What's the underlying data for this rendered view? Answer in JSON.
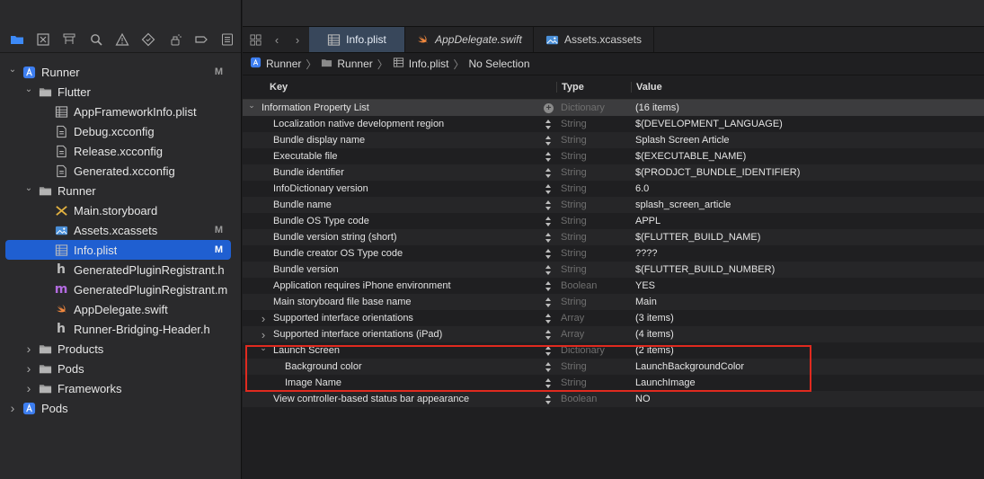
{
  "navigator": {
    "toolbar_icons": [
      "folder-icon",
      "source-control-icon",
      "hierarchy-icon",
      "search-icon",
      "issue-warning-icon",
      "test-diamond-icon",
      "debug-spray-icon",
      "breakpoint-icon",
      "report-list-icon"
    ],
    "tree": [
      {
        "label": "Runner",
        "badge": "M",
        "icon": "xcode-project-icon",
        "depth": 0,
        "disclosure": "open"
      },
      {
        "label": "Flutter",
        "badge": "",
        "icon": "folder-icon",
        "depth": 1,
        "disclosure": "open"
      },
      {
        "label": "AppFrameworkInfo.plist",
        "badge": "",
        "icon": "plist-table-icon",
        "depth": 2,
        "disclosure": ""
      },
      {
        "label": "Debug.xcconfig",
        "badge": "",
        "icon": "config-file-icon",
        "depth": 2,
        "disclosure": ""
      },
      {
        "label": "Release.xcconfig",
        "badge": "",
        "icon": "config-file-icon",
        "depth": 2,
        "disclosure": ""
      },
      {
        "label": "Generated.xcconfig",
        "badge": "",
        "icon": "config-file-icon",
        "depth": 2,
        "disclosure": ""
      },
      {
        "label": "Runner",
        "badge": "",
        "icon": "folder-icon",
        "depth": 1,
        "disclosure": "open"
      },
      {
        "label": "Main.storyboard",
        "badge": "",
        "icon": "storyboard-icon",
        "depth": 2,
        "disclosure": ""
      },
      {
        "label": "Assets.xcassets",
        "badge": "M",
        "icon": "asset-catalog-icon",
        "depth": 2,
        "disclosure": ""
      },
      {
        "label": "Info.plist",
        "badge": "M",
        "icon": "plist-table-icon",
        "depth": 2,
        "disclosure": "",
        "selected": true
      },
      {
        "label": "GeneratedPluginRegistrant.h",
        "badge": "",
        "icon": "header-file-icon",
        "depth": 2,
        "disclosure": ""
      },
      {
        "label": "GeneratedPluginRegistrant.m",
        "badge": "",
        "icon": "objc-file-icon",
        "depth": 2,
        "disclosure": ""
      },
      {
        "label": "AppDelegate.swift",
        "badge": "",
        "icon": "swift-icon",
        "depth": 2,
        "disclosure": ""
      },
      {
        "label": "Runner-Bridging-Header.h",
        "badge": "",
        "icon": "header-file-icon",
        "depth": 2,
        "disclosure": ""
      },
      {
        "label": "Products",
        "badge": "",
        "icon": "folder-icon",
        "depth": 1,
        "disclosure": "closed"
      },
      {
        "label": "Pods",
        "badge": "",
        "icon": "folder-icon",
        "depth": 1,
        "disclosure": "closed"
      },
      {
        "label": "Frameworks",
        "badge": "",
        "icon": "folder-icon",
        "depth": 1,
        "disclosure": "closed"
      },
      {
        "label": "Pods",
        "badge": "",
        "icon": "xcode-project-icon",
        "depth": 0,
        "disclosure": "closed"
      }
    ]
  },
  "editor": {
    "tabs": [
      {
        "label": "Info.plist",
        "icon": "plist-table-icon",
        "active": true,
        "italic": false
      },
      {
        "label": "AppDelegate.swift",
        "icon": "swift-icon",
        "active": false,
        "italic": true
      },
      {
        "label": "Assets.xcassets",
        "icon": "asset-catalog-icon",
        "active": false,
        "italic": false
      }
    ],
    "jumpbar": [
      "Runner",
      "Runner",
      "Info.plist",
      "No Selection"
    ],
    "plist": {
      "headers": {
        "key": "Key",
        "type": "Type",
        "value": "Value"
      },
      "rows": [
        {
          "key": "Information Property List",
          "type": "Dictionary",
          "value": "(16 items)",
          "level": 0,
          "disclosure": "open",
          "ctrl": "plus"
        },
        {
          "key": "Localization native development region",
          "type": "String",
          "value": "$(DEVELOPMENT_LANGUAGE)",
          "level": 1,
          "disclosure": "",
          "ctrl": "stepper"
        },
        {
          "key": "Bundle display name",
          "type": "String",
          "value": "Splash Screen Article",
          "level": 1,
          "disclosure": "",
          "ctrl": "stepper"
        },
        {
          "key": "Executable file",
          "type": "String",
          "value": "$(EXECUTABLE_NAME)",
          "level": 1,
          "disclosure": "",
          "ctrl": "stepper"
        },
        {
          "key": "Bundle identifier",
          "type": "String",
          "value": "$(PRODJCT_BUNDLE_IDENTIFIER)",
          "level": 1,
          "disclosure": "",
          "ctrl": "stepper"
        },
        {
          "key": "InfoDictionary version",
          "type": "String",
          "value": "6.0",
          "level": 1,
          "disclosure": "",
          "ctrl": "stepper"
        },
        {
          "key": "Bundle name",
          "type": "String",
          "value": "splash_screen_article",
          "level": 1,
          "disclosure": "",
          "ctrl": "stepper"
        },
        {
          "key": "Bundle OS Type code",
          "type": "String",
          "value": "APPL",
          "level": 1,
          "disclosure": "",
          "ctrl": "stepper"
        },
        {
          "key": "Bundle version string (short)",
          "type": "String",
          "value": "$(FLUTTER_BUILD_NAME)",
          "level": 1,
          "disclosure": "",
          "ctrl": "stepper"
        },
        {
          "key": "Bundle creator OS Type code",
          "type": "String",
          "value": "????",
          "level": 1,
          "disclosure": "",
          "ctrl": "stepper"
        },
        {
          "key": "Bundle version",
          "type": "String",
          "value": "$(FLUTTER_BUILD_NUMBER)",
          "level": 1,
          "disclosure": "",
          "ctrl": "stepper"
        },
        {
          "key": "Application requires iPhone environment",
          "type": "Boolean",
          "value": "YES",
          "level": 1,
          "disclosure": "",
          "ctrl": "stepper"
        },
        {
          "key": "Main storyboard file base name",
          "type": "String",
          "value": "Main",
          "level": 1,
          "disclosure": "",
          "ctrl": "stepper"
        },
        {
          "key": "Supported interface orientations",
          "type": "Array",
          "value": "(3 items)",
          "level": 1,
          "disclosure": "closed",
          "ctrl": "stepper"
        },
        {
          "key": "Supported interface orientations (iPad)",
          "type": "Array",
          "value": "(4 items)",
          "level": 1,
          "disclosure": "closed",
          "ctrl": "stepper"
        },
        {
          "key": "Launch Screen",
          "type": "Dictionary",
          "value": "(2 items)",
          "level": 1,
          "disclosure": "open",
          "ctrl": "stepper"
        },
        {
          "key": "Background color",
          "type": "String",
          "value": "LaunchBackgroundColor",
          "level": 2,
          "disclosure": "",
          "ctrl": "stepper"
        },
        {
          "key": "Image Name",
          "type": "String",
          "value": "LaunchImage",
          "level": 2,
          "disclosure": "",
          "ctrl": "stepper"
        },
        {
          "key": "View controller-based status bar appearance",
          "type": "Boolean",
          "value": "NO",
          "level": 1,
          "disclosure": "",
          "ctrl": "stepper"
        }
      ]
    }
  },
  "colors": {
    "selection": "#1f5fd1",
    "highlight_box": "#e02a1f",
    "active_tab": "#38475b",
    "swift": "#f0883e",
    "objc_m": "#b36be0"
  }
}
